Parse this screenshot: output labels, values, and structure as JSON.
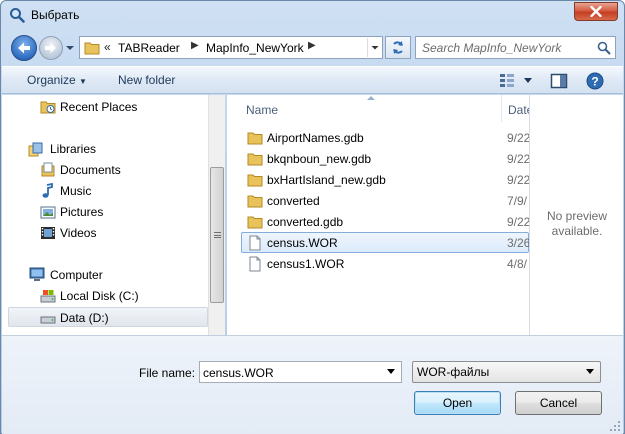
{
  "window": {
    "title": "Выбрать",
    "accent": "#3c7fb1"
  },
  "address": {
    "overflow": "«",
    "crumbs": [
      "TABReader",
      "MapInfo_NewYork"
    ]
  },
  "search": {
    "placeholder": "Search MapInfo_NewYork"
  },
  "toolbar": {
    "organize_label": "Organize",
    "new_folder_label": "New folder"
  },
  "nav_pane": {
    "items": [
      {
        "label": "Recent Places",
        "icon": "recent-places-icon"
      },
      {
        "label": "Libraries",
        "icon": "libraries-icon"
      },
      {
        "label": "Documents",
        "icon": "documents-icon"
      },
      {
        "label": "Music",
        "icon": "music-icon"
      },
      {
        "label": "Pictures",
        "icon": "pictures-icon"
      },
      {
        "label": "Videos",
        "icon": "videos-icon"
      },
      {
        "label": "Computer",
        "icon": "computer-icon"
      },
      {
        "label": "Local Disk (C:)",
        "icon": "local-disk-icon"
      },
      {
        "label": "Data (D:)",
        "icon": "data-drive-icon"
      }
    ]
  },
  "file_list": {
    "columns": [
      "Name",
      "Date"
    ],
    "rows": [
      {
        "name": "AirportNames.gdb",
        "date": "9/22",
        "type": "folder"
      },
      {
        "name": "bkqnboun_new.gdb",
        "date": "9/22",
        "type": "folder"
      },
      {
        "name": "bxHartIsland_new.gdb",
        "date": "9/22",
        "type": "folder"
      },
      {
        "name": "converted",
        "date": "7/9/",
        "type": "folder"
      },
      {
        "name": "converted.gdb",
        "date": "9/22",
        "type": "folder"
      },
      {
        "name": "census.WOR",
        "date": "3/26",
        "type": "file"
      },
      {
        "name": "census1.WOR",
        "date": "4/8/",
        "type": "file"
      }
    ]
  },
  "preview": {
    "line1": "No preview",
    "line2": "available."
  },
  "bottom": {
    "file_name_label": "File name:",
    "file_name_value": "census.WOR",
    "file_type_value": "WOR-файлы",
    "open_label": "Open",
    "cancel_label": "Cancel"
  }
}
